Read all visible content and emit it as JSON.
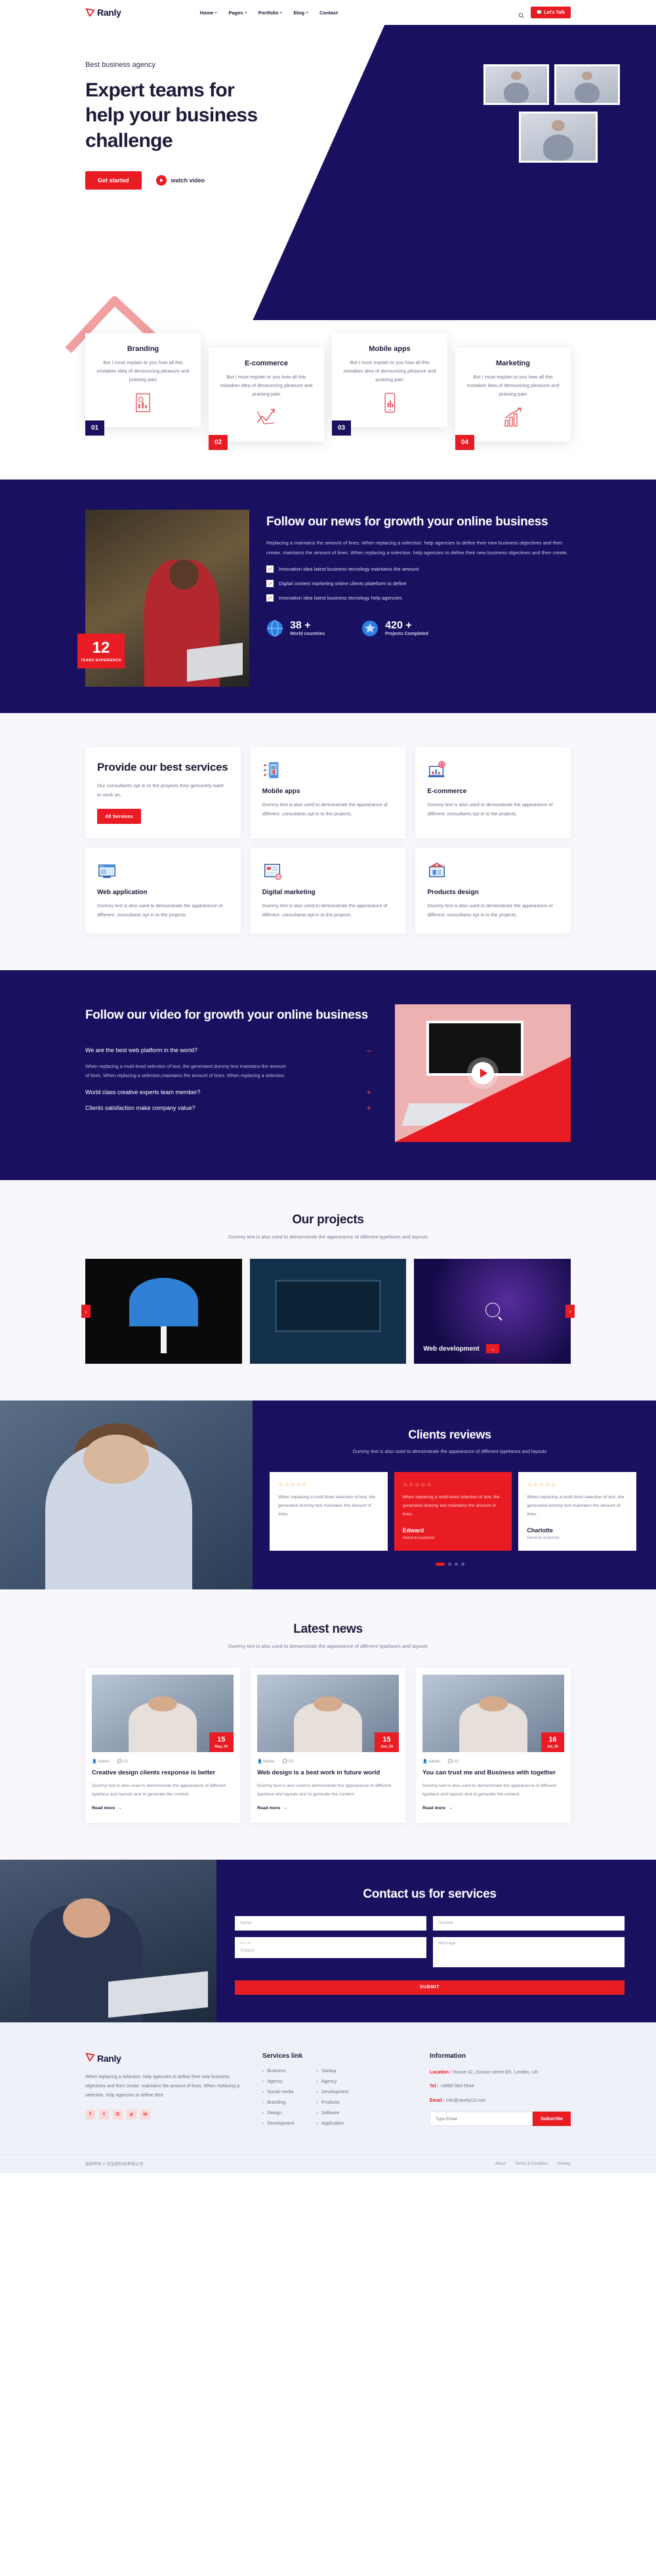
{
  "brand": {
    "name": "Ranly"
  },
  "nav": {
    "items": [
      {
        "label": "Home",
        "caret": true
      },
      {
        "label": "Pages",
        "caret": true
      },
      {
        "label": "Portfolio",
        "caret": true
      },
      {
        "label": "Blog",
        "caret": true
      },
      {
        "label": "Contact",
        "caret": false
      }
    ],
    "search_icon": "search-icon",
    "cta": "Let's Talk"
  },
  "hero": {
    "eyebrow": "Best business agency",
    "title": "Expert teams for help your business challenge",
    "primary_btn": "Get started",
    "video_btn": "watch video"
  },
  "service_cards": [
    {
      "num": "01",
      "title": "Branding",
      "text": "But I must explain to you how all this mistaken idea of denouncing pleasure and praising pain"
    },
    {
      "num": "02",
      "title": "E-commerce",
      "text": "But I must explain to you how all this mistaken idea of denouncing pleasure and praising pain"
    },
    {
      "num": "03",
      "title": "Mobile apps",
      "text": "But I must explain to you how all this mistaken idea of denouncing pleasure and praising pain"
    },
    {
      "num": "04",
      "title": "Marketing",
      "text": "But I must explain to you how all this mistaken idea of denouncing pleasure and praising pain"
    }
  ],
  "news": {
    "years_number": "12",
    "years_label": "YEARS EXPERIENCE",
    "title": "Follow our news for growth your online business",
    "paragraph": "Replacing a maintains the amount of lines. When replacing a selection. help agencies to define their new business objectives and then create. maintains the amount of lines. When replacing a selection. help agencies to define their new business objectives and then create.",
    "checks": [
      "Innovation idea latest business tecnology maintains the amount",
      "Digital content marketing online clients plateform to define",
      "Innovation idea latest business tecnology help agencies."
    ],
    "stats": [
      {
        "number": "38 +",
        "label": "World countries",
        "icon": "globe-icon"
      },
      {
        "number": "420 +",
        "label": "Projects Completed",
        "icon": "badge-icon"
      }
    ]
  },
  "provide": {
    "title": "Provide our best services",
    "intro": "Our consultants opt in to the projects they genuinely want to work on.",
    "button": "All Services",
    "cards": [
      {
        "icon": "mobile-ad-icon",
        "title": "Mobile apps",
        "text": "Dummy text is also used to demonstrate the appearance of different. consultants opt in to the projects."
      },
      {
        "icon": "ecommerce-chart-icon",
        "title": "E-commerce",
        "text": "Dummy text is also used to demonstrate the appearance of different. consultants opt in to the projects."
      },
      {
        "icon": "web-application-icon",
        "title": "Web application",
        "text": "Dummy text is also used to demonstrate the appearance of different. consultants opt in to the projects."
      },
      {
        "icon": "digital-marketing-icon",
        "title": "Digital marketing",
        "text": "Dummy text is also used to demonstrate the appearance of different. consultants opt in to the projects."
      },
      {
        "icon": "products-design-icon",
        "title": "Products design",
        "text": "Dummy text is also used to demonstrate the appearance of different. consultants opt in to the projects."
      }
    ]
  },
  "video": {
    "title": "Follow our video for growth your online business",
    "accordion": [
      {
        "q": "We are the best web platform in the world?",
        "sign": "–",
        "open": true,
        "a": "When replacing a multi-lined selection of text, the generated dummy text maintains the amount of lines. When replacing a selection.maintains the amount of lines. When replacing a selection"
      },
      {
        "q": "World class creative experts team member?",
        "sign": "+",
        "open": false,
        "a": ""
      },
      {
        "q": "Clients satisfaction make company value?",
        "sign": "+",
        "open": false,
        "a": ""
      }
    ],
    "play_icon": "play-icon"
  },
  "projects": {
    "title": "Our projects",
    "subtitle": "Dummy text is also used to demonstrate the appearance of different typefaces and layouts",
    "items": [
      {
        "label": "",
        "arrow": ""
      },
      {
        "label": "",
        "arrow": ""
      },
      {
        "label": "Web development",
        "arrow": "→"
      }
    ],
    "prev": "‹",
    "next": "›"
  },
  "reviews": {
    "title": "Clients reviews",
    "subtitle": "Dummy text is also used to demonstrate the appearance of different typefaces and layouts",
    "cards": [
      {
        "stars": "☆☆☆☆☆",
        "text": "When replacing a multi-lined selection of text, the generated dummy text maintains the amount of lines.",
        "name": "",
        "role": "",
        "highlight": false
      },
      {
        "stars": "☆☆☆☆☆",
        "text": "When replacing a multi-lined selection of text, the generated dummy text maintains the amount of lines.",
        "name": "Edward",
        "role": "General customer",
        "highlight": true
      },
      {
        "stars": "☆☆☆☆☆",
        "text": "When replacing a multi-lined selection of text, the generated dummy text maintains the amount of lines.",
        "name": "Charlotte",
        "role": "General customer",
        "highlight": false
      }
    ],
    "dots": [
      true,
      false,
      false,
      false
    ]
  },
  "latest_news": {
    "title": "Latest news",
    "subtitle": "Dummy text is also used to demonstrate the appearance of different typefaces and layouts",
    "posts": [
      {
        "day": "15",
        "month": "May, 20",
        "author": "Admin",
        "comments": "02",
        "title": "Creative design clients response is better",
        "text": "Dummy text is also used to demonstrate the appearance of different typeface and layouts and to generate the content.",
        "more": "Read more"
      },
      {
        "day": "15",
        "month": "Jun, 20",
        "author": "Admin",
        "comments": "02",
        "title": "Web design is a best work in future world",
        "text": "Dummy text is also used to demonstrate the appearance of different typeface and layouts and to generate the content.",
        "more": "Read more"
      },
      {
        "day": "16",
        "month": "Jul, 20",
        "author": "Admin",
        "comments": "02",
        "title": "You can trust me and Business with together",
        "text": "Dummy text is also used to demonstrate the appearance of different typeface and layouts and to generate the content.",
        "more": "Read more"
      }
    ]
  },
  "contact": {
    "title": "Contact us for services",
    "fields": {
      "name": "Name",
      "number": "Number",
      "email": "Email",
      "subject": "Subject",
      "message": "Message"
    },
    "submit": "SUBMIT"
  },
  "footer": {
    "brand": "Ranly",
    "about": "When replacing a selection. help agencies to define their new business objectives and then create. maintains the amount of lines. When replacing a selection. help agencies to define their",
    "socials": [
      "f",
      "t",
      "G",
      "p",
      "in"
    ],
    "services_title": "Services link",
    "services_col1": [
      "Business",
      "Agency",
      "Social media",
      "Branding",
      "Design",
      "Development"
    ],
    "services_col2": [
      "Startup",
      "Agency",
      "Development",
      "Products",
      "Software",
      "Application"
    ],
    "information_title": "Information",
    "location_label": "Location :",
    "location_value": "House-32, Zonson street-3/5, London, UK",
    "tel_label": "Tel :",
    "tel_value": "+0890-564-5644",
    "email_label": "Email :",
    "email_value": "info@ranely13.com",
    "subscribe_placeholder": "Type Email",
    "subscribe_btn": "Subscribe",
    "copyright": "版权所有 © 优加星科技有限公司",
    "bottom_links": [
      "About",
      "Terms & Condition",
      "Privacy"
    ]
  },
  "colors": {
    "primary": "#1a1060",
    "accent": "#e91b23",
    "light": "#f7f7fc"
  }
}
